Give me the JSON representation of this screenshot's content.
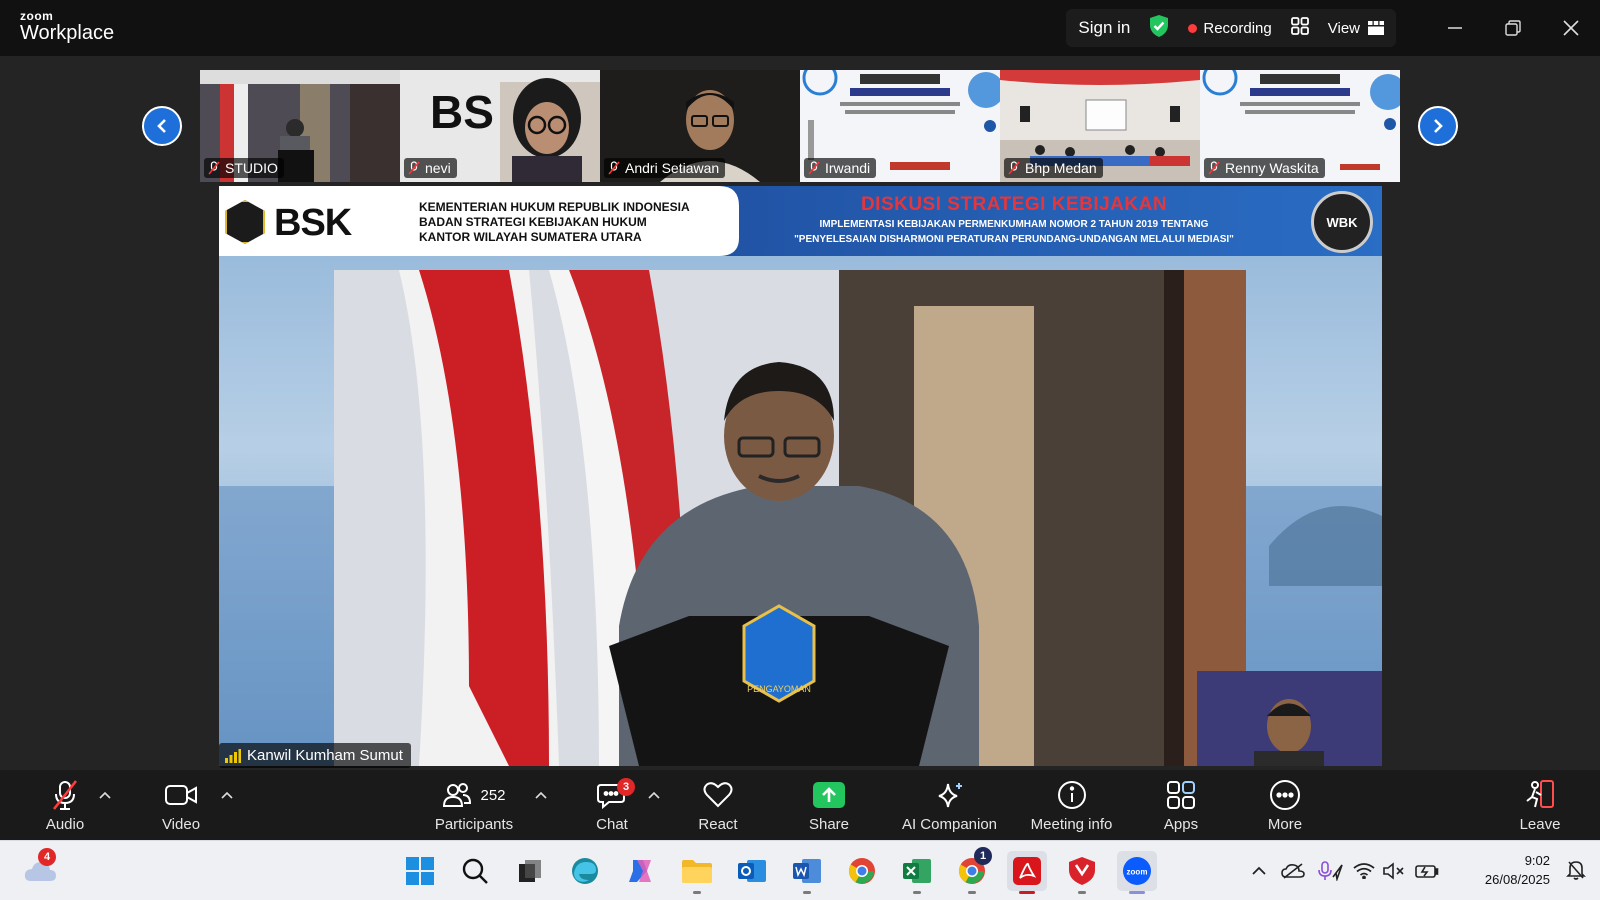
{
  "app": {
    "brand_top": "zoom",
    "brand_bottom": "Workplace"
  },
  "titlebar": {
    "sign_in": "Sign in",
    "recording": "Recording",
    "view": "View"
  },
  "thumbnails": [
    {
      "name": "STUDIO"
    },
    {
      "name": "nevi"
    },
    {
      "name": "Andri Setiawan"
    },
    {
      "name": "Irwandi"
    },
    {
      "name": "Bhp Medan"
    },
    {
      "name": "Renny Waskita"
    }
  ],
  "main_video": {
    "speaker": "Kanwil Kumham Sumut",
    "banner": {
      "org_line1": "KEMENTERIAN HUKUM REPUBLIK INDONESIA",
      "org_line2": "BADAN STRATEGI KEBIJAKAN HUKUM",
      "org_line3": "KANTOR WILAYAH SUMATERA UTARA",
      "logo_text": "BSK",
      "title": "DISKUSI STRATEGI KEBIJAKAN",
      "subtitle1": "IMPLEMENTASI KEBIJAKAN PERMENKUMHAM NOMOR 2 TAHUN 2019 TENTANG",
      "subtitle2": "\"PENYELESAIAN DISHARMONI PERATURAN PERUNDANG-UNDANGAN MELALUI MEDIASI\"",
      "seal": "WBK",
      "podium": "PENGAYOMAN"
    }
  },
  "toolbar": {
    "audio": "Audio",
    "video": "Video",
    "participants": "Participants",
    "participants_count": "252",
    "chat": "Chat",
    "chat_badge": "3",
    "react": "React",
    "share": "Share",
    "ai_companion": "AI Companion",
    "meeting_info": "Meeting info",
    "apps": "Apps",
    "more": "More",
    "leave": "Leave"
  },
  "taskbar": {
    "weather_badge": "4",
    "time": "9:02",
    "date": "26/08/2025",
    "chrome_badge": "1"
  },
  "colors": {
    "accent": "#1e6fd9",
    "recording": "#ff3b3b",
    "share": "#22c55e",
    "badge": "#e02828"
  }
}
